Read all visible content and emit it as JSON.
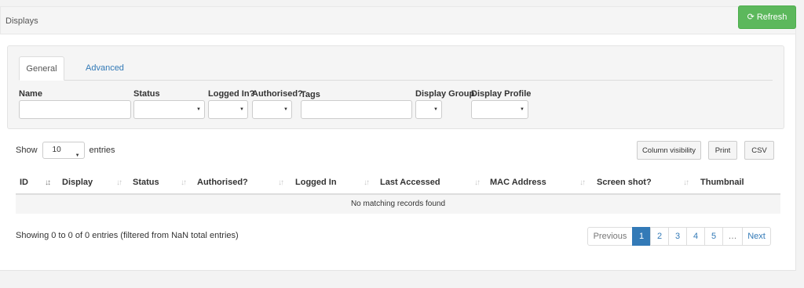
{
  "header": {
    "title": "Displays",
    "refresh_label": "Refresh",
    "refresh_icon": "refresh-icon",
    "refresh_color": "#5cb85c"
  },
  "filters": {
    "tabs": [
      {
        "label": "General",
        "active": true
      },
      {
        "label": "Advanced",
        "active": false
      }
    ],
    "name_label": "Name",
    "name_value": "",
    "status_label": "Status",
    "status_value": "",
    "logged_in_label": "Logged In?",
    "logged_in_value": "",
    "authorised_label": "Authorised?",
    "authorised_value": "",
    "tags_label": "Tags",
    "tags_value": "",
    "display_group_label": "Display Group",
    "display_group_value": "",
    "display_profile_label": "Display Profile",
    "display_profile_value": ""
  },
  "table_controls": {
    "show_label": "Show",
    "entries_value": "10",
    "entries_label": "entries",
    "column_visibility_label": "Column visibility",
    "print_label": "Print",
    "csv_label": "CSV"
  },
  "table": {
    "columns": [
      "ID",
      "Display",
      "Status",
      "Authorised?",
      "Logged In",
      "Last Accessed",
      "MAC Address",
      "Screen shot?",
      "Thumbnail"
    ],
    "empty_message": "No matching records found",
    "sorted_column": "ID"
  },
  "footer": {
    "info": "Showing 0 to 0 of 0 entries (filtered from NaN total entries)"
  },
  "pagination": {
    "previous_label": "Previous",
    "pages": [
      "1",
      "2",
      "3",
      "4",
      "5",
      "…"
    ],
    "current_page": "1",
    "next_label": "Next",
    "active_color": "#337ab7"
  }
}
